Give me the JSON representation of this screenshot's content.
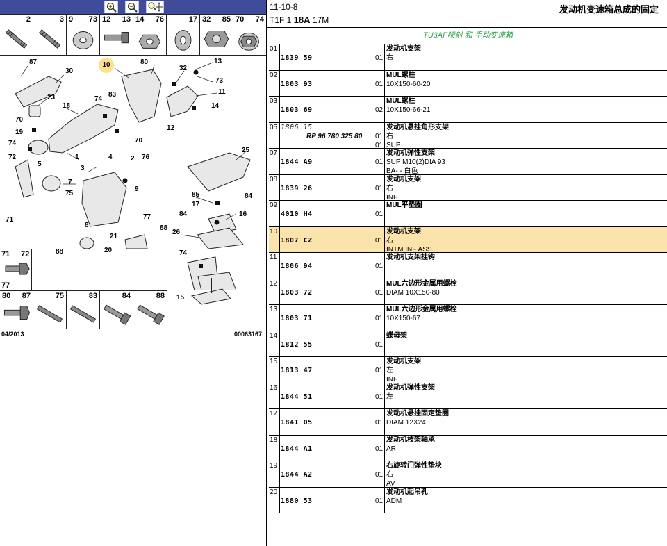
{
  "toolbar": {
    "zoom_in_icon": "zoom-in-icon",
    "zoom_out_icon": "zoom-out-icon",
    "zoom_pan_icon": "zoom-pan-icon"
  },
  "top_thumbs": [
    {
      "a": "",
      "b": "2"
    },
    {
      "a": "",
      "b": "3"
    },
    {
      "a": "9",
      "b": "73"
    },
    {
      "a": "12",
      "b": "13"
    },
    {
      "a": "14",
      "b": "76"
    },
    {
      "a": "",
      "b": "17"
    },
    {
      "a": "32",
      "b": "85"
    },
    {
      "a": "70",
      "b": "74"
    }
  ],
  "callouts": [
    {
      "t": "87",
      "hl": false
    },
    {
      "t": "30",
      "hl": false
    },
    {
      "t": "10",
      "hl": true
    },
    {
      "t": "80",
      "hl": false
    },
    {
      "t": "32",
      "hl": false
    },
    {
      "t": "13",
      "hl": false
    },
    {
      "t": "73",
      "hl": false
    },
    {
      "t": "11",
      "hl": false
    },
    {
      "t": "14",
      "hl": false
    },
    {
      "t": "83",
      "hl": false
    },
    {
      "t": "23",
      "hl": false
    },
    {
      "t": "18",
      "hl": false
    },
    {
      "t": "74",
      "hl": false
    },
    {
      "t": "70",
      "hl": false
    },
    {
      "t": "19",
      "hl": false
    },
    {
      "t": "12",
      "hl": false
    },
    {
      "t": "74",
      "hl": false
    },
    {
      "t": "70",
      "hl": false
    },
    {
      "t": "72",
      "hl": false
    },
    {
      "t": "5",
      "hl": false
    },
    {
      "t": "1",
      "hl": false
    },
    {
      "t": "3",
      "hl": false
    },
    {
      "t": "4",
      "hl": false
    },
    {
      "t": "2",
      "hl": false
    },
    {
      "t": "76",
      "hl": false
    },
    {
      "t": "7",
      "hl": false
    },
    {
      "t": "9",
      "hl": false
    },
    {
      "t": "25",
      "hl": false
    },
    {
      "t": "75",
      "hl": false
    },
    {
      "t": "85",
      "hl": false
    },
    {
      "t": "84",
      "hl": false
    },
    {
      "t": "17",
      "hl": false
    },
    {
      "t": "84",
      "hl": false
    },
    {
      "t": "16",
      "hl": false
    },
    {
      "t": "71",
      "hl": false
    },
    {
      "t": "8",
      "hl": false
    },
    {
      "t": "77",
      "hl": false
    },
    {
      "t": "26",
      "hl": false
    },
    {
      "t": "21",
      "hl": false
    },
    {
      "t": "88",
      "hl": false
    },
    {
      "t": "20",
      "hl": false
    },
    {
      "t": "74",
      "hl": false
    },
    {
      "t": "88",
      "hl": false
    },
    {
      "t": "15",
      "hl": false
    }
  ],
  "small_box": {
    "a": "71",
    "b": "72",
    "c": "77"
  },
  "bottom_thumbs": [
    {
      "a": "80",
      "b": "87"
    },
    {
      "a": "",
      "b": "75"
    },
    {
      "a": "",
      "b": "83"
    },
    {
      "a": "",
      "b": "84"
    },
    {
      "a": "",
      "b": "88"
    }
  ],
  "footer": {
    "date": "04/2013",
    "figure_code": "00063167"
  },
  "header": {
    "code1": "11-10-8",
    "code2_prefix": "T1F 1 ",
    "code2_bold": "18A",
    "code2_suffix": " 17M",
    "title": "发动机变速箱总成的固定"
  },
  "subtitle": "TU3AF喷射 和 手动变速箱",
  "rows": [
    {
      "idx": "01",
      "part": "1839 59",
      "ref": "",
      "qty": "01",
      "qty3": "",
      "d1": "发动机支架",
      "d2": "右",
      "d3": "",
      "selected": false
    },
    {
      "idx": "02",
      "part": "1803 93",
      "ref": "",
      "qty": "01",
      "qty3": "",
      "d1": "MUL螺柱",
      "d2": "10X150-60-20",
      "d3": "",
      "selected": false
    },
    {
      "idx": "03",
      "part": "1803 69",
      "ref": "",
      "qty": "02",
      "qty3": "",
      "d1": "MUL螺柱",
      "d2": "10X150-66-21",
      "d3": "",
      "selected": false
    },
    {
      "idx": "05",
      "part": "1806 15",
      "ref": "RP 96 780 325 80",
      "qty": "01",
      "qty3": "01",
      "d1": "发动机悬挂角形支架",
      "d2": "右",
      "d3": "SUP",
      "selected": false,
      "italic": true
    },
    {
      "idx": "07",
      "part": "1844 A9",
      "ref": "",
      "qty": "01",
      "qty3": "",
      "d1": "发动机弹性支架",
      "d2": "SUP M10(2)DIA 93",
      "d3": "BA- - 白色",
      "selected": false
    },
    {
      "idx": "08",
      "part": "1839 26",
      "ref": "",
      "qty": "01",
      "qty3": "",
      "d1": "发动机支架",
      "d2": "右",
      "d3": "INF",
      "selected": false
    },
    {
      "idx": "09",
      "part": "4010 H4",
      "ref": "",
      "qty": "01",
      "qty3": "",
      "d1": "MUL平垫圈",
      "d2": "",
      "d3": "",
      "selected": false
    },
    {
      "idx": "10",
      "part": "1807 CZ",
      "ref": "",
      "qty": "01",
      "qty3": "",
      "d1": "发动机支架",
      "d2": "右",
      "d3": "INTM INF ASS",
      "selected": true
    },
    {
      "idx": "11",
      "part": "1806 94",
      "ref": "",
      "qty": "01",
      "qty3": "",
      "d1": "发动机支架挂钩",
      "d2": "",
      "d3": "",
      "selected": false
    },
    {
      "idx": "12",
      "part": "1803 72",
      "ref": "",
      "qty": "01",
      "qty3": "",
      "d1": "MUL六边形金属用螺栓",
      "d2": "DIAM 10X150-80",
      "d3": "",
      "selected": false
    },
    {
      "idx": "13",
      "part": "1803 71",
      "ref": "",
      "qty": "01",
      "qty3": "",
      "d1": "MUL六边形金属用螺栓",
      "d2": "10X150-67",
      "d3": "",
      "selected": false
    },
    {
      "idx": "14",
      "part": "1812 55",
      "ref": "",
      "qty": "01",
      "qty3": "",
      "d1": "蝶母架",
      "d2": "",
      "d3": "",
      "selected": false
    },
    {
      "idx": "15",
      "part": "1813 47",
      "ref": "",
      "qty": "01",
      "qty3": "",
      "d1": "发动机支架",
      "d2": "左",
      "d3": "INF",
      "selected": false
    },
    {
      "idx": "16",
      "part": "1844 51",
      "ref": "",
      "qty": "01",
      "qty3": "",
      "d1": "发动机弹性支架",
      "d2": "左",
      "d3": "",
      "selected": false
    },
    {
      "idx": "17",
      "part": "1841 05",
      "ref": "",
      "qty": "01",
      "qty3": "",
      "d1": "发动机悬挂固定垫圈",
      "d2": "DIAM 12X24",
      "d3": "",
      "selected": false
    },
    {
      "idx": "18",
      "part": "1844 A1",
      "ref": "",
      "qty": "01",
      "qty3": "",
      "d1": "发动机枝架轴承",
      "d2": "AR",
      "d3": "",
      "selected": false
    },
    {
      "idx": "19",
      "part": "1844 A2",
      "ref": "",
      "qty": "01",
      "qty3": "",
      "d1": "右旋转门弹性垫块",
      "d2": "右",
      "d3": "AV",
      "selected": false
    },
    {
      "idx": "20",
      "part": "1880 53",
      "ref": "",
      "qty": "01",
      "qty3": "",
      "d1": "发动机起吊孔",
      "d2": "ADM",
      "d3": "",
      "selected": false
    }
  ]
}
